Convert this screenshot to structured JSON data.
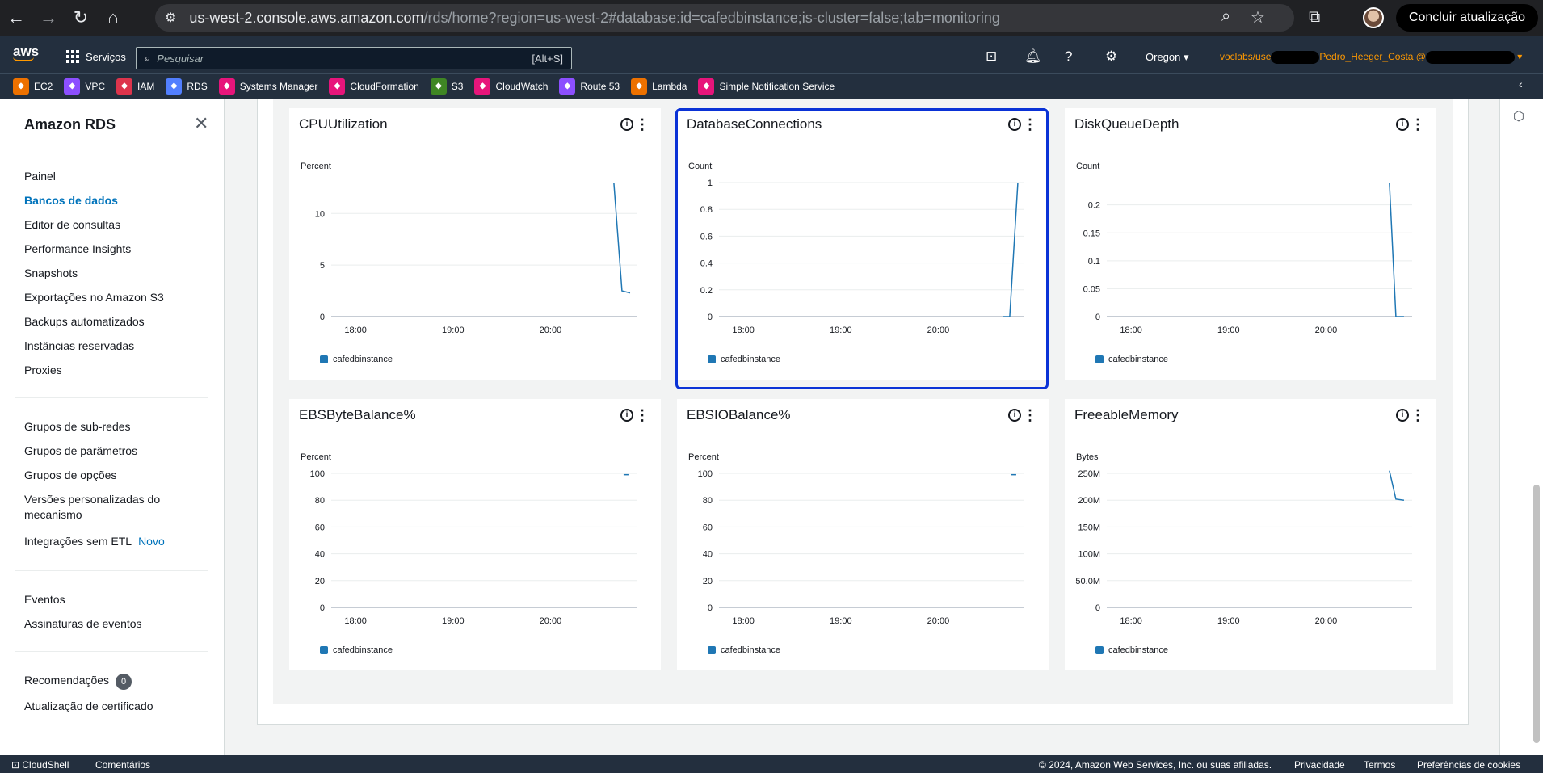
{
  "browser": {
    "url_host": "us-west-2.console.aws.amazon.com",
    "url_path": "/rds/home?region=us-west-2#database:id=cafedbinstance;is-cluster=false;tab=monitoring",
    "update_button": "Concluir atualização"
  },
  "aws_nav": {
    "logo": "aws",
    "services_label": "Serviços",
    "search_placeholder": "Pesquisar",
    "search_shortcut": "[Alt+S]",
    "region": "Oregon",
    "account_prefix": "voclabs/use",
    "account_name": "Pedro_Heeger_Costa @"
  },
  "favorites": [
    {
      "label": "EC2",
      "color": "#ed7100"
    },
    {
      "label": "VPC",
      "color": "#8c4fff"
    },
    {
      "label": "IAM",
      "color": "#dd344c"
    },
    {
      "label": "RDS",
      "color": "#527fff"
    },
    {
      "label": "Systems Manager",
      "color": "#e7157b"
    },
    {
      "label": "CloudFormation",
      "color": "#e7157b"
    },
    {
      "label": "S3",
      "color": "#3f8624"
    },
    {
      "label": "CloudWatch",
      "color": "#e7157b"
    },
    {
      "label": "Route 53",
      "color": "#8c4fff"
    },
    {
      "label": "Lambda",
      "color": "#ed7100"
    },
    {
      "label": "Simple Notification Service",
      "color": "#e7157b"
    }
  ],
  "sidebar": {
    "title": "Amazon RDS",
    "items": [
      "Painel",
      "Bancos de dados",
      "Editor de consultas",
      "Performance Insights",
      "Snapshots",
      "Exportações no Amazon S3",
      "Backups automatizados",
      "Instâncias reservadas",
      "Proxies",
      "Grupos de sub-redes",
      "Grupos de parâmetros",
      "Grupos de opções",
      "Versões personalizadas do",
      "mecanismo",
      "Integrações sem ETL",
      "Eventos",
      "Assinaturas de eventos",
      "Recomendações",
      "Atualização de certificado"
    ],
    "new_label": "Novo",
    "recommendations_count": "0"
  },
  "charts": [
    {
      "title": "CPUUtilization",
      "unit": "Percent",
      "yticks": [
        "10",
        "5",
        "0"
      ],
      "xticks": [
        "18:00",
        "19:00",
        "20:00"
      ],
      "legend": "cafedbinstance"
    },
    {
      "title": "DatabaseConnections",
      "unit": "Count",
      "yticks": [
        "1",
        "0.8",
        "0.6",
        "0.4",
        "0.2",
        "0"
      ],
      "xticks": [
        "18:00",
        "19:00",
        "20:00"
      ],
      "legend": "cafedbinstance"
    },
    {
      "title": "DiskQueueDepth",
      "unit": "Count",
      "yticks": [
        "0.2",
        "0.15",
        "0.1",
        "0.05",
        "0"
      ],
      "xticks": [
        "18:00",
        "19:00",
        "20:00"
      ],
      "legend": "cafedbinstance"
    },
    {
      "title": "EBSByteBalance%",
      "unit": "Percent",
      "yticks": [
        "100",
        "80",
        "60",
        "40",
        "20",
        "0"
      ],
      "xticks": [
        "18:00",
        "19:00",
        "20:00"
      ],
      "legend": "cafedbinstance"
    },
    {
      "title": "EBSIOBalance%",
      "unit": "Percent",
      "yticks": [
        "100",
        "80",
        "60",
        "40",
        "20",
        "0"
      ],
      "xticks": [
        "18:00",
        "19:00",
        "20:00"
      ],
      "legend": "cafedbinstance"
    },
    {
      "title": "FreeableMemory",
      "unit": "Bytes",
      "yticks": [
        "250M",
        "200M",
        "150M",
        "100M",
        "50.0M",
        "0"
      ],
      "xticks": [
        "18:00",
        "19:00",
        "20:00"
      ],
      "legend": "cafedbinstance"
    }
  ],
  "chart_data": [
    {
      "type": "line",
      "title": "CPUUtilization",
      "ylabel": "Percent",
      "x": [
        "20:39",
        "20:44",
        "20:49"
      ],
      "series": [
        {
          "name": "cafedbinstance",
          "values": [
            13,
            2.5,
            2.3
          ]
        }
      ],
      "ylim": [
        0,
        13
      ]
    },
    {
      "type": "line",
      "title": "DatabaseConnections",
      "ylabel": "Count",
      "x": [
        "20:40",
        "20:44",
        "20:49"
      ],
      "series": [
        {
          "name": "cafedbinstance",
          "values": [
            0,
            0,
            1
          ]
        }
      ],
      "ylim": [
        0,
        1
      ]
    },
    {
      "type": "line",
      "title": "DiskQueueDepth",
      "ylabel": "Count",
      "x": [
        "20:39",
        "20:43",
        "20:48"
      ],
      "series": [
        {
          "name": "cafedbinstance",
          "values": [
            0.24,
            0,
            0
          ]
        }
      ],
      "ylim": [
        0,
        0.24
      ]
    },
    {
      "type": "line",
      "title": "EBSByteBalance%",
      "ylabel": "Percent",
      "x": [
        "20:45",
        "20:48"
      ],
      "series": [
        {
          "name": "cafedbinstance",
          "values": [
            99,
            99
          ]
        }
      ],
      "ylim": [
        0,
        100
      ]
    },
    {
      "type": "line",
      "title": "EBSIOBalance%",
      "ylabel": "Percent",
      "x": [
        "20:45",
        "20:48"
      ],
      "series": [
        {
          "name": "cafedbinstance",
          "values": [
            99,
            99
          ]
        }
      ],
      "ylim": [
        0,
        100
      ]
    },
    {
      "type": "line",
      "title": "FreeableMemory",
      "ylabel": "Bytes",
      "x": [
        "20:39",
        "20:43",
        "20:48"
      ],
      "series": [
        {
          "name": "cafedbinstance",
          "values": [
            255000000,
            202000000,
            200000000
          ]
        }
      ],
      "ylim": [
        0,
        250000000
      ]
    }
  ],
  "footer": {
    "cloudshell": "CloudShell",
    "comments": "Comentários",
    "copyright": "© 2024, Amazon Web Services, Inc. ou suas afiliadas.",
    "privacy": "Privacidade",
    "terms": "Termos",
    "cookies": "Preferências de cookies"
  }
}
